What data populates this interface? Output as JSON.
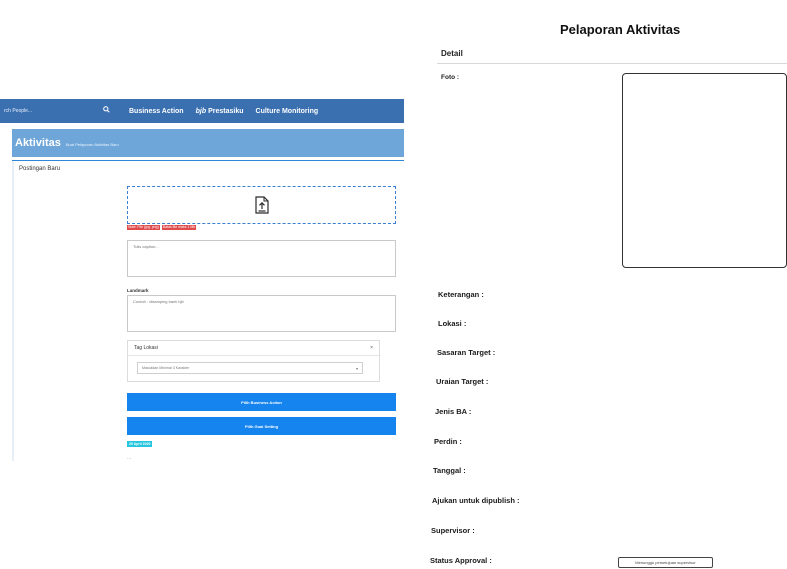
{
  "left": {
    "navbar": {
      "search_placeholder": "rch People...",
      "links": [
        "Business Action",
        "Prestasiku",
        "Culture Monitoring"
      ],
      "bjb_mark": "bjb"
    },
    "header": {
      "title": "Aktivitas",
      "subtitle": "Buat Pelaporan Aktivitas Baru"
    },
    "post_label": "Postingan Baru",
    "warnings": [
      "Note: File (jpg, png)",
      "Batas file maks 1 Mb"
    ],
    "caption_placeholder": "Tulis caption...",
    "landmark_label": "Landmark",
    "landmark_placeholder": "Contoh : disamping bank bjb",
    "tag_card": {
      "title": "Tag Lokasi",
      "close": "×",
      "select_value": "Masukkan Minimal 3 Karakter",
      "caret": "▾"
    },
    "buttons": {
      "business_action": "Pilih Business Action",
      "goal_setting": "Pilih Goal Setting"
    },
    "date_chip": "20 April 2020",
    "dots": "..."
  },
  "right": {
    "title": "Pelaporan Aktivitas",
    "detail": "Detail",
    "fields": {
      "foto": "Foto :",
      "keterangan": "Keterangan :",
      "lokasi": "Lokasi :",
      "sasaran_target": "Sasaran Target :",
      "uraian_target": "Uraian Target :",
      "jenis_ba": "Jenis BA :",
      "perdin": "Perdin :",
      "tanggal": "Tanggal :",
      "ajukan": "Ajukan untuk dipublish :",
      "supervisor": "Supervisor :",
      "status_approval": "Status Approval :"
    },
    "status_pill": "Menunggu persetujuan supervisor"
  },
  "colors": {
    "navbar": "#3a6fb0",
    "header_band": "#6fa6d9",
    "button": "#1584ee",
    "date_chip": "#27c6df",
    "warning": "#e04c4c"
  },
  "icons": {
    "search": "search-icon",
    "upload": "upload-file-icon",
    "close": "close-icon",
    "caret": "chevron-down-icon"
  }
}
